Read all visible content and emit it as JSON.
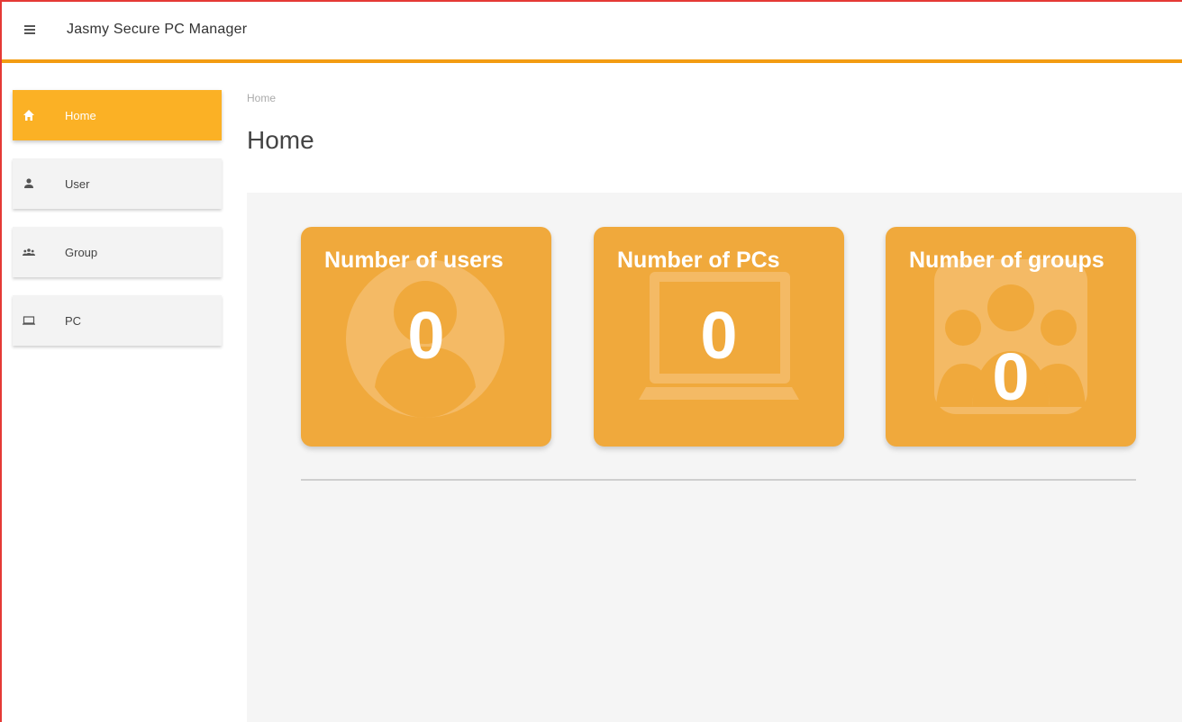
{
  "app": {
    "title": "Jasmy Secure PC Manager"
  },
  "sidebar": {
    "items": [
      {
        "label": "Home",
        "icon": "home-icon",
        "active": true
      },
      {
        "label": "User",
        "icon": "user-icon",
        "active": false
      },
      {
        "label": "Group",
        "icon": "group-icon",
        "active": false
      },
      {
        "label": "PC",
        "icon": "laptop-icon",
        "active": false
      }
    ]
  },
  "main": {
    "breadcrumb": "Home",
    "title": "Home",
    "cards": [
      {
        "title": "Number of users",
        "value": "0",
        "icon": "user-avatar-icon"
      },
      {
        "title": "Number of PCs",
        "value": "0",
        "icon": "laptop-icon"
      },
      {
        "title": "Number of groups",
        "value": "0",
        "icon": "group-icon"
      }
    ]
  },
  "colors": {
    "accent": "#fbb125",
    "card": "#f0a93c",
    "topbar_border": "#f39c12"
  }
}
